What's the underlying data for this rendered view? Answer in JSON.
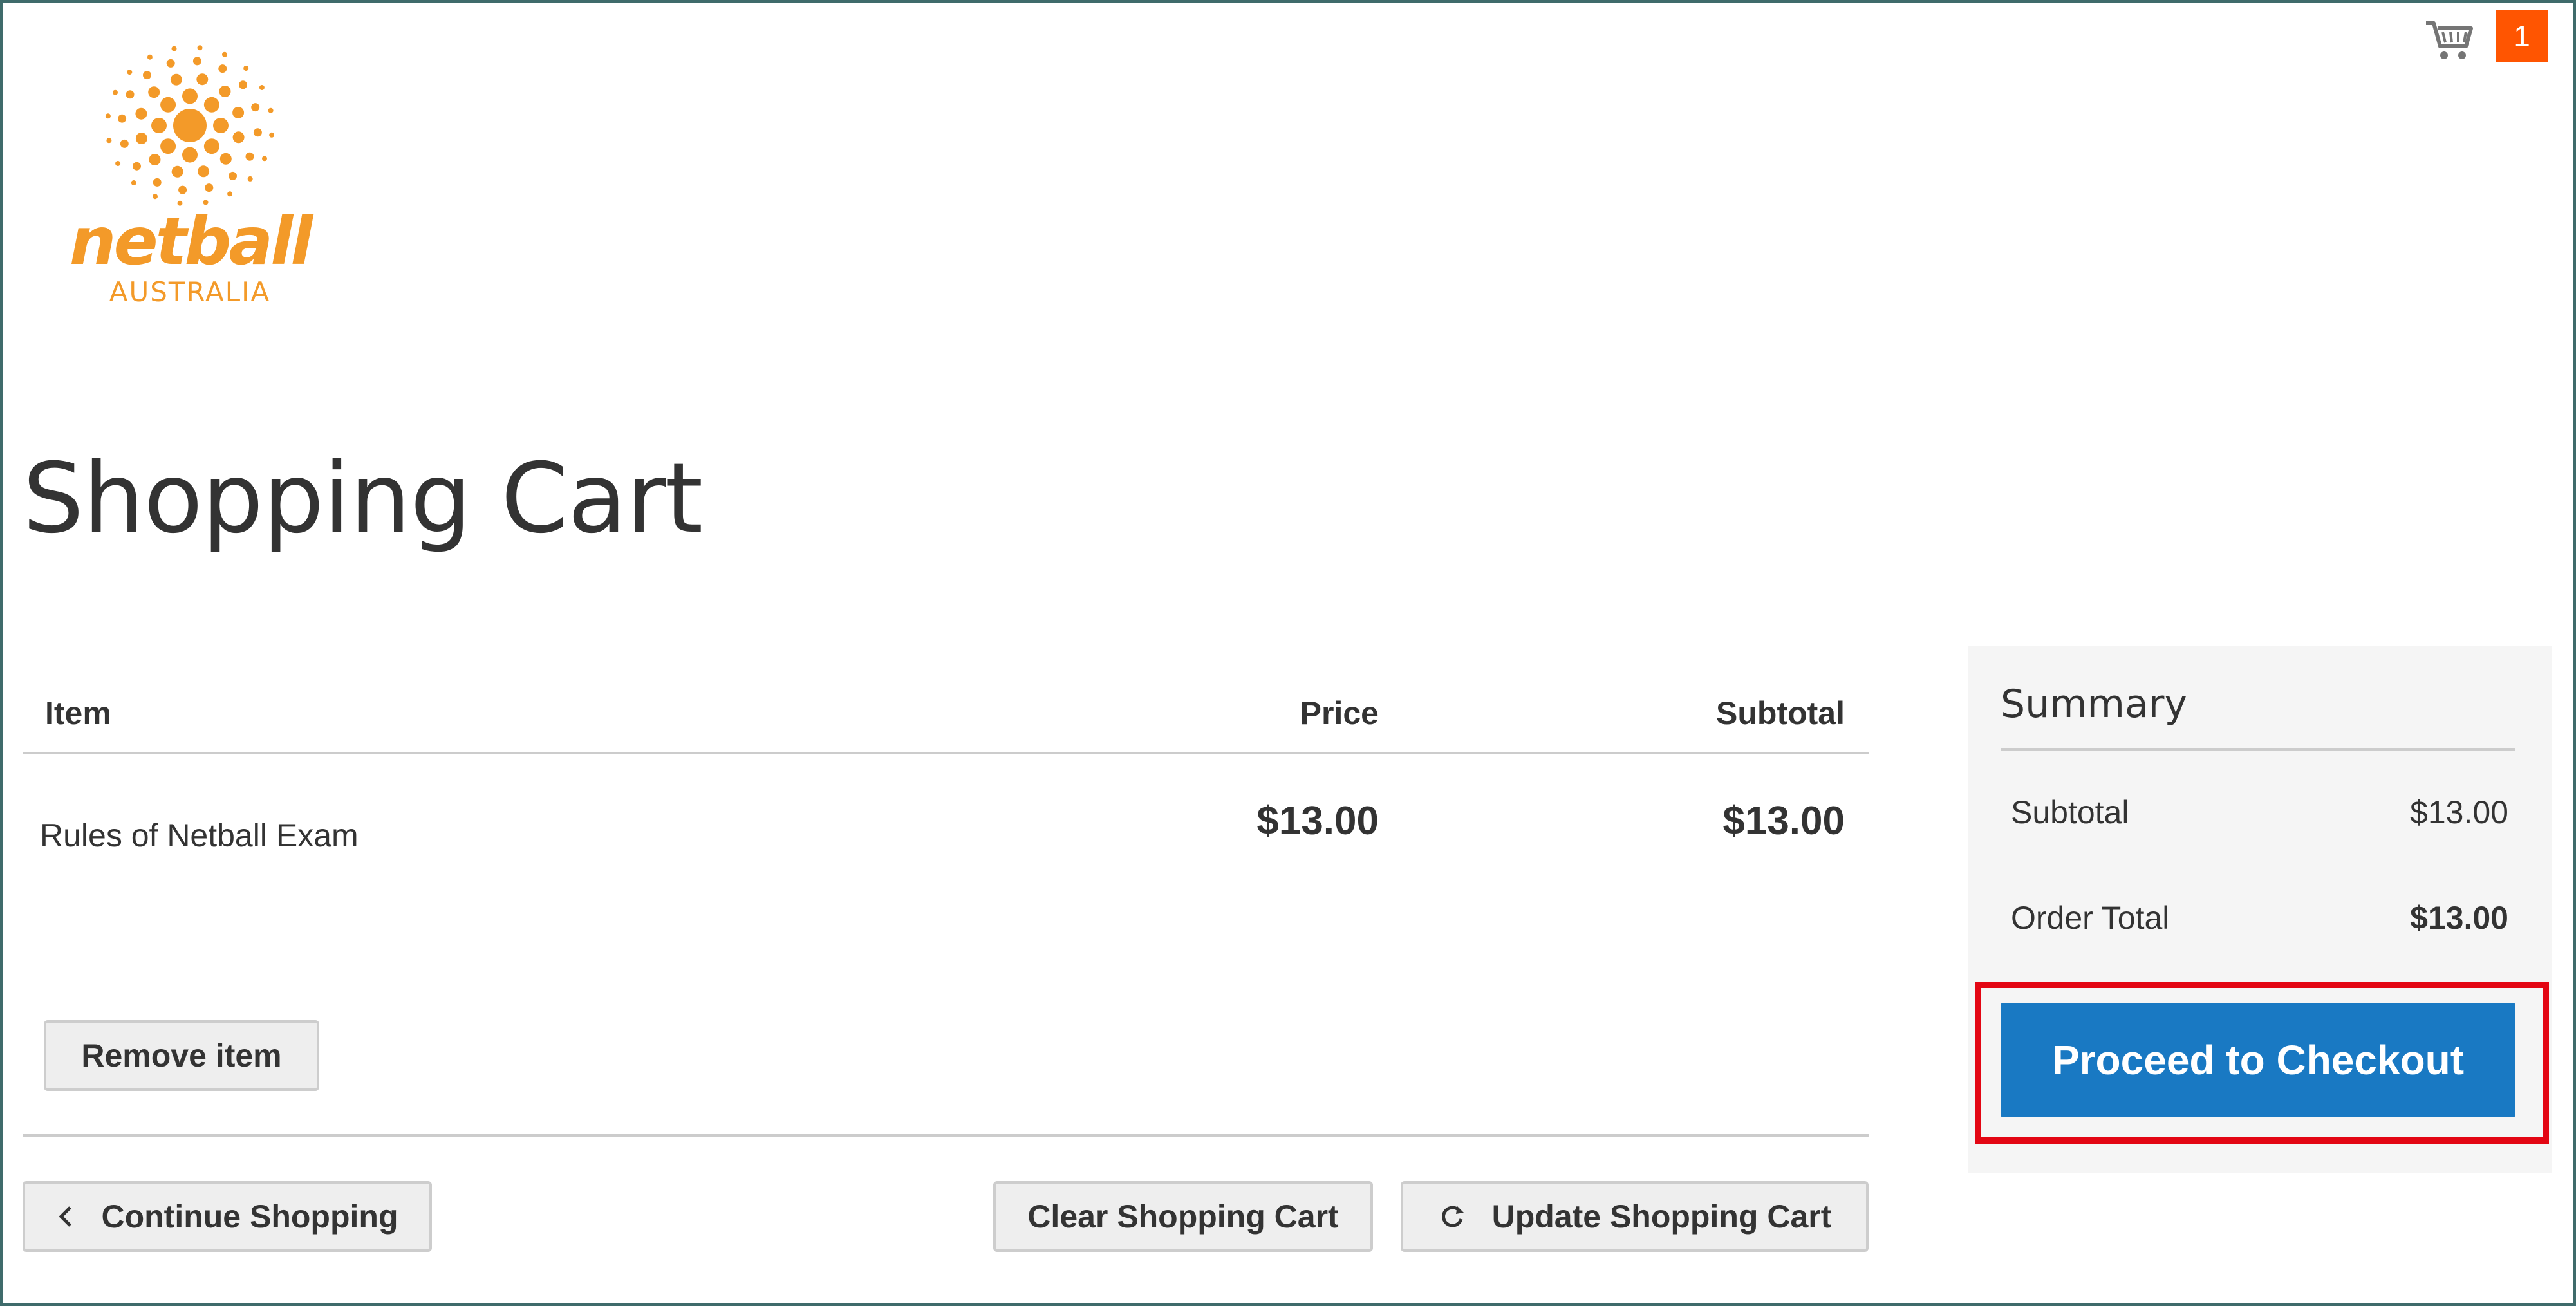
{
  "header": {
    "logo": {
      "word": "netball",
      "subtitle": "AUSTRALIA",
      "color": "#f39a29"
    },
    "cart": {
      "icon": "cart-icon",
      "count": "1",
      "badge_color": "#ff5501"
    }
  },
  "page": {
    "title": "Shopping Cart"
  },
  "cart_table": {
    "headers": {
      "item": "Item",
      "price": "Price",
      "subtotal": "Subtotal"
    },
    "rows": [
      {
        "name": "Rules of Netball Exam",
        "price": "$13.00",
        "subtotal": "$13.00"
      }
    ],
    "remove_label": "Remove item"
  },
  "actions": {
    "continue_label": "Continue Shopping",
    "continue_icon": "chevron-left-icon",
    "clear_label": "Clear Shopping Cart",
    "update_label": "Update Shopping Cart",
    "update_icon": "refresh-icon"
  },
  "summary": {
    "title": "Summary",
    "subtotal_label": "Subtotal",
    "subtotal_value": "$13.00",
    "order_total_label": "Order Total",
    "order_total_value": "$13.00",
    "checkout_label": "Proceed to Checkout",
    "checkout_color": "#1979c3",
    "highlight_color": "#e30613"
  }
}
